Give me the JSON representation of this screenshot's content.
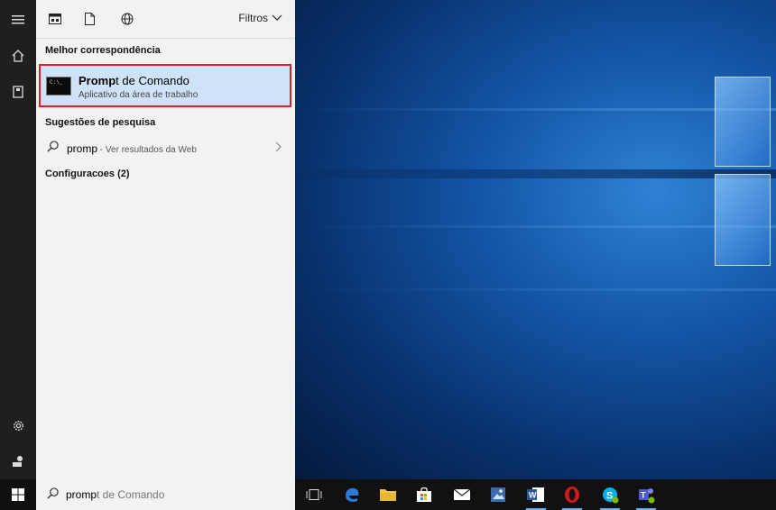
{
  "panel": {
    "filters_label": "Filtros",
    "best_match_header": "Melhor correspondência",
    "best_match": {
      "title_bold": "Promp",
      "title_rest": "t de Comando",
      "subtitle": "Aplicativo da área de trabalho",
      "icon_text": "C:\\_"
    },
    "suggestions_header": "Sugestões de pesquisa",
    "suggestion": {
      "query": "promp",
      "tail": " - Ver resultados da Web"
    },
    "settings_header": "Configuracoes (2)"
  },
  "search": {
    "typed": "promp",
    "ghost": "t de Comando"
  },
  "colors": {
    "highlight_border": "#e31b23",
    "highlight_bg": "#cfe3f8"
  }
}
